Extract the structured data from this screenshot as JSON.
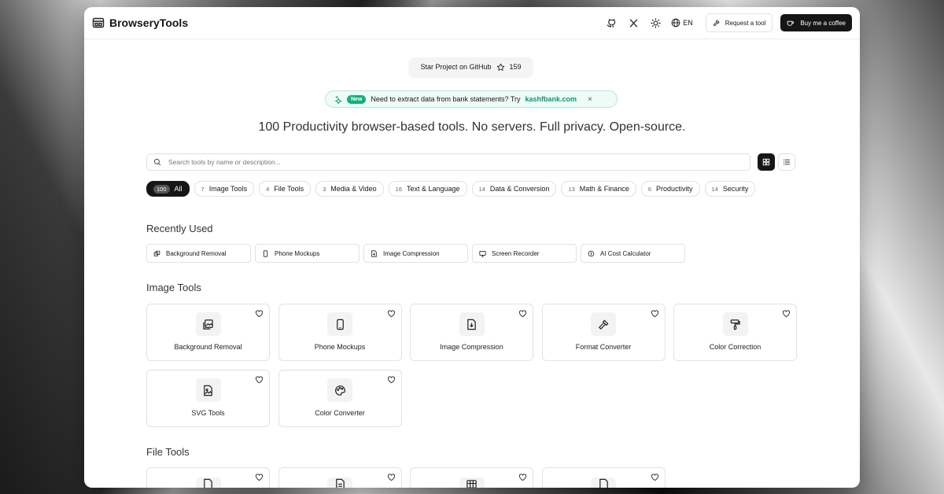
{
  "header": {
    "logo_text": "BrowseryTools",
    "lang": "EN",
    "request_label": "Request a tool",
    "coffee_label": "Buy me a coffee"
  },
  "github": {
    "label": "Star Project on GitHub",
    "stars": "159"
  },
  "banner": {
    "badge": "New",
    "text": "Need to extract data from bank statements? Try",
    "link": "kashfbank.com",
    "close": "×"
  },
  "headline": "100 Productivity browser-based tools. No servers. Full privacy. Open-source.",
  "search": {
    "placeholder": "Search tools by name or description..."
  },
  "chips": [
    {
      "count": "100",
      "label": "All"
    },
    {
      "count": "7",
      "label": "Image Tools"
    },
    {
      "count": "4",
      "label": "File Tools"
    },
    {
      "count": "3",
      "label": "Media & Video"
    },
    {
      "count": "16",
      "label": "Text & Language"
    },
    {
      "count": "14",
      "label": "Data & Conversion"
    },
    {
      "count": "13",
      "label": "Math & Finance"
    },
    {
      "count": "6",
      "label": "Productivity"
    },
    {
      "count": "14",
      "label": "Security"
    }
  ],
  "recently_used": {
    "title": "Recently Used",
    "items": [
      "Background Removal",
      "Phone Mockups",
      "Image Compression",
      "Screen Recorder",
      "AI Cost Calculator"
    ]
  },
  "image_tools": {
    "title": "Image Tools",
    "cards": [
      "Background Removal",
      "Phone Mockups",
      "Image Compression",
      "Format Converter",
      "Color Correction",
      "SVG Tools",
      "Color Converter"
    ]
  },
  "file_tools": {
    "title": "File Tools"
  },
  "colors": {
    "accent": "#161616",
    "new_badge": "#10b07c",
    "link": "#0a9a6a"
  }
}
